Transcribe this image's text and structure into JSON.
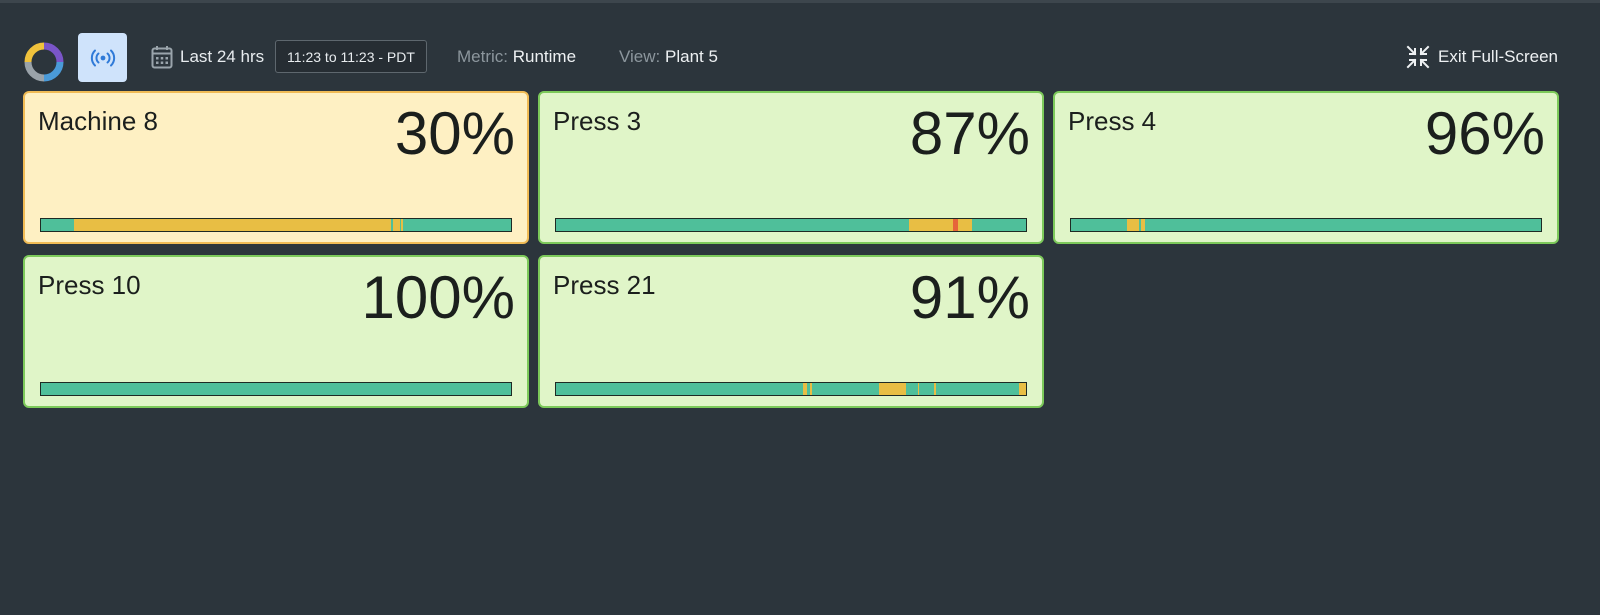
{
  "toolbar": {
    "range_label": "Last 24 hrs",
    "time_range": "11:23 to 11:23 - PDT",
    "metric_label": "Metric:",
    "metric_value": "Runtime",
    "view_label": "View:",
    "view_value": "Plant 5",
    "exit_label": "Exit Full-Screen",
    "icons": [
      "logo-ring",
      "broadcast-icon",
      "calendar-icon",
      "collapse-icon"
    ]
  },
  "colors": {
    "background": "#2c353c",
    "good_card": "#e0f5c8",
    "good_border": "#7cc95a",
    "warn_card": "#fef0c3",
    "warn_border": "#f0bb55",
    "running": "#4fbf9a",
    "idle": "#e8be44",
    "down": "#e6653a"
  },
  "machines": [
    {
      "name": "Machine 8",
      "percent": "30%",
      "status": "warn",
      "timeline": [
        {
          "start": 0.07,
          "end": 0.745,
          "state": "idle"
        },
        {
          "start": 0.748,
          "end": 0.763,
          "state": "idle"
        },
        {
          "start": 0.766,
          "end": 0.77,
          "state": "idle"
        }
      ]
    },
    {
      "name": "Press 3",
      "percent": "87%",
      "status": "good",
      "timeline": [
        {
          "start": 0.75,
          "end": 0.845,
          "state": "idle"
        },
        {
          "start": 0.845,
          "end": 0.855,
          "state": "down"
        },
        {
          "start": 0.855,
          "end": 0.885,
          "state": "idle"
        }
      ]
    },
    {
      "name": "Press 4",
      "percent": "96%",
      "status": "good",
      "timeline": [
        {
          "start": 0.12,
          "end": 0.145,
          "state": "idle"
        },
        {
          "start": 0.148,
          "end": 0.158,
          "state": "idle"
        }
      ]
    },
    {
      "name": "Press 10",
      "percent": "100%",
      "status": "good",
      "timeline": []
    },
    {
      "name": "Press 21",
      "percent": "91%",
      "status": "good",
      "timeline": [
        {
          "start": 0.525,
          "end": 0.535,
          "state": "idle"
        },
        {
          "start": 0.54,
          "end": 0.545,
          "state": "idle"
        },
        {
          "start": 0.688,
          "end": 0.744,
          "state": "idle"
        },
        {
          "start": 0.77,
          "end": 0.773,
          "state": "idle"
        },
        {
          "start": 0.805,
          "end": 0.808,
          "state": "idle"
        },
        {
          "start": 0.985,
          "end": 1.0,
          "state": "idle"
        }
      ]
    }
  ]
}
